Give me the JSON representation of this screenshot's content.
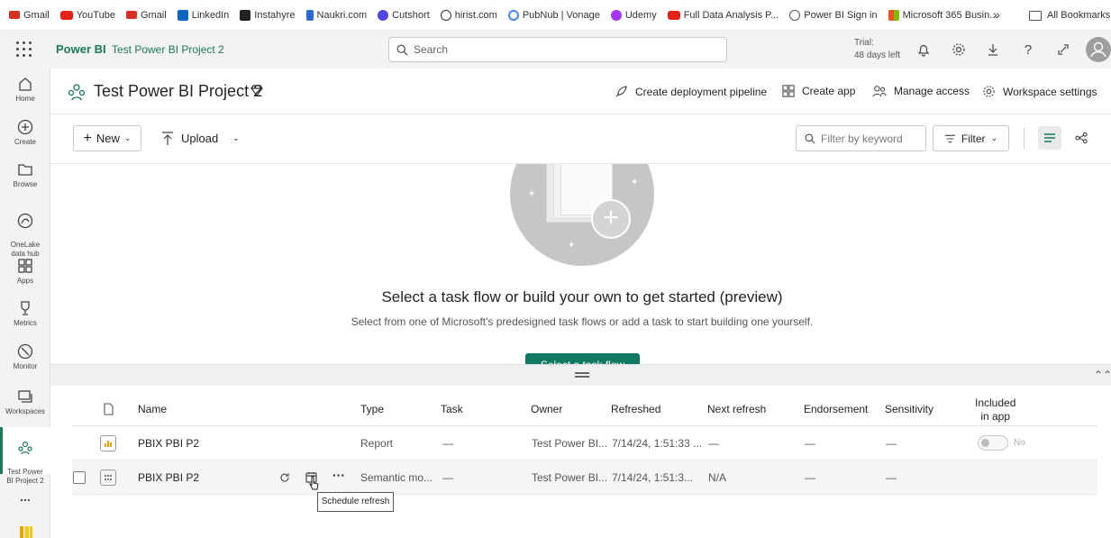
{
  "bookmarks": [
    {
      "label": "Gmail",
      "icon": "gmail-icon",
      "color": "#d93025"
    },
    {
      "label": "YouTube",
      "icon": "youtube-icon",
      "color": "#e62117"
    },
    {
      "label": "Gmail",
      "icon": "gmail-icon",
      "color": "#d93025"
    },
    {
      "label": "LinkedIn",
      "icon": "linkedin-icon",
      "color": "#0a66c2"
    },
    {
      "label": "Instahyre",
      "icon": "instahyre-icon",
      "color": "#222222"
    },
    {
      "label": "Naukri.com",
      "icon": "naukri-icon",
      "color": "#2a6ad8"
    },
    {
      "label": "Cutshort",
      "icon": "cutshort-icon",
      "color": "#4f46e5"
    },
    {
      "label": "hirist.com",
      "icon": "hirist-icon",
      "color": "#333333"
    },
    {
      "label": "PubNub | Vonage",
      "icon": "google-icon",
      "color": "#4285f4"
    },
    {
      "label": "Udemy",
      "icon": "udemy-icon",
      "color": "#a435f0"
    },
    {
      "label": "Full Data Analysis P...",
      "icon": "youtube-icon",
      "color": "#e62117"
    },
    {
      "label": "Power BI Sign in",
      "icon": "globe-icon",
      "color": "#555555"
    },
    {
      "label": "Microsoft 365 Busin...",
      "icon": "microsoft-icon",
      "color": "#f25022"
    }
  ],
  "bookmarks_all": "All Bookmarks",
  "appbar": {
    "brand": "Power BI",
    "breadcrumb": "Test Power BI Project 2",
    "search_placeholder": "Search",
    "trial_line1": "Trial:",
    "trial_line2": "48 days left"
  },
  "leftnav": [
    {
      "label": "Home",
      "icon": "home-icon"
    },
    {
      "label": "Create",
      "icon": "plus-circle-icon"
    },
    {
      "label": "Browse",
      "icon": "folder-icon"
    },
    {
      "label": "OneLake\ndata hub",
      "icon": "onelake-icon"
    },
    {
      "label": "Apps",
      "icon": "apps-icon"
    },
    {
      "label": "Metrics",
      "icon": "trophy-icon"
    },
    {
      "label": "Monitor",
      "icon": "monitor-icon"
    },
    {
      "label": "Workspaces",
      "icon": "workspaces-icon"
    },
    {
      "label": "Test Power\nBI Project 2",
      "icon": "workspace-people-icon"
    },
    {
      "label": "...",
      "icon": "more-icon"
    }
  ],
  "workspace": {
    "title": "Test Power BI Project 2",
    "actions": {
      "deployment": "Create deployment pipeline",
      "create_app": "Create app",
      "manage_access": "Manage access",
      "settings": "Workspace settings"
    }
  },
  "toolbar": {
    "new_label": "New",
    "upload_label": "Upload",
    "filter_placeholder": "Filter by keyword",
    "filter_label": "Filter"
  },
  "taskflow": {
    "title": "Select a task flow or build your own to get started (preview)",
    "subtitle": "Select from one of Microsoft's predesigned task flows or add a task to start building one yourself.",
    "button_label": "Select a task flow"
  },
  "table": {
    "headers": {
      "name": "Name",
      "type": "Type",
      "task": "Task",
      "owner": "Owner",
      "refreshed": "Refreshed",
      "next_refresh": "Next refresh",
      "endorsement": "Endorsement",
      "sensitivity": "Sensitivity",
      "included_line1": "Included",
      "included_line2": "in app"
    },
    "rows": [
      {
        "name": "PBIX PBI P2",
        "type": "Report",
        "task": "—",
        "owner": "Test Power BI...",
        "refreshed": "7/14/24, 1:51:33 ...",
        "next_refresh": "—",
        "endorsement": "—",
        "sensitivity": "—",
        "included": "No"
      },
      {
        "name": "PBIX PBI P2",
        "type": "Semantic mo...",
        "task": "—",
        "owner": "Test Power BI...",
        "refreshed": "7/14/24, 1:51:3...",
        "next_refresh": "N/A",
        "endorsement": "—",
        "sensitivity": "—"
      }
    ]
  },
  "tooltip": "Schedule refresh",
  "colors": {
    "brand": "#1c7a56",
    "accent_button": "#117865"
  }
}
